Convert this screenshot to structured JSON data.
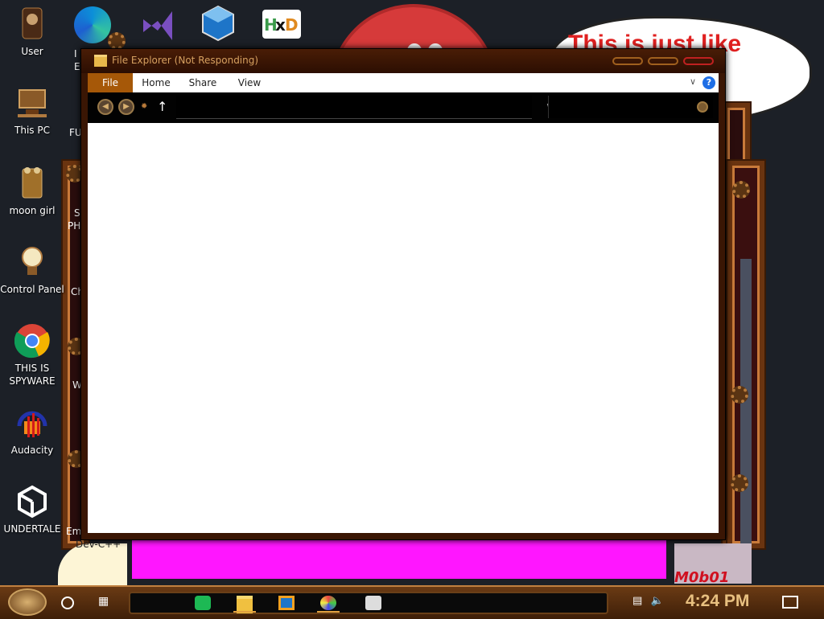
{
  "desktop": {
    "icons": [
      {
        "label": "User"
      },
      {
        "label": "This PC"
      },
      {
        "label": "moon girl"
      },
      {
        "label": "Control Panel"
      },
      {
        "label": "THIS IS SPYWARE"
      },
      {
        "label": "Audacity"
      },
      {
        "label": "UNDERTALE"
      }
    ],
    "partial_labels": [
      "I",
      "E",
      "FU",
      "S",
      "PHC",
      "Ch",
      "W",
      "Emi",
      "Dev-C++"
    ],
    "top_icons": [
      "edge-icon",
      "visual-studio-icon",
      "virtualbox-icon",
      "hxd-icon"
    ],
    "speech_bubble_text": "This is just like ell's",
    "bottom_right_text": "M0b01"
  },
  "window": {
    "title": "File Explorer (Not Responding)",
    "ribbon_tabs": [
      "File",
      "Home",
      "Share",
      "View"
    ],
    "help_label": "?",
    "address_value": "",
    "search_value": ""
  },
  "taskbar": {
    "clock": "4:24 PM",
    "apps": [
      "spotify-icon",
      "file-explorer-icon",
      "virtualbox-icon",
      "paint-icon",
      "notepad-icon"
    ]
  },
  "colors": {
    "desktop_bg": "#1c2027",
    "accent_bronze": "#a65808",
    "clock_color": "#e8c080",
    "magenta_block": "#ff16ff"
  }
}
